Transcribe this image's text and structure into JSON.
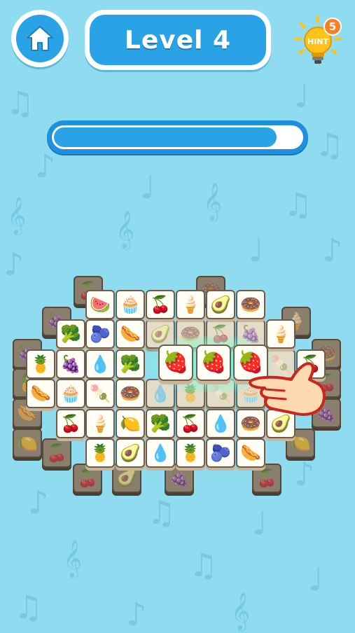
{
  "header": {
    "level_label": "Level 4",
    "home_icon": "home-icon",
    "hint_label": "HINT",
    "hint_count": "5",
    "hint_icon": "lightbulb-icon"
  },
  "progress": {
    "fraction": 0.9
  },
  "colors": {
    "background": "#8fdcf0",
    "button_blue": "#2aa3e6",
    "progress_border": "#1f8fe0",
    "hint_badge": "#fb7f22",
    "hint_bulb": "#ffc21a",
    "highlight": "#7affd2"
  },
  "board": {
    "tiles": [
      {
        "name": "watermelon",
        "icon": "🍉",
        "layer": "top"
      },
      {
        "name": "cupcake",
        "icon": "🧁",
        "layer": "top"
      },
      {
        "name": "cherries",
        "icon": "🍒",
        "layer": "top"
      },
      {
        "name": "ice-cream",
        "icon": "🍦",
        "layer": "top"
      },
      {
        "name": "avocado",
        "icon": "🥑",
        "layer": "top"
      },
      {
        "name": "donut",
        "icon": "🍩",
        "layer": "top"
      },
      {
        "name": "broccoli",
        "icon": "🥦",
        "layer": "top"
      },
      {
        "name": "blueberries",
        "icon": "🫐",
        "layer": "top"
      },
      {
        "name": "hot-dog",
        "icon": "🌭",
        "layer": "top"
      },
      {
        "name": "avocado",
        "icon": "🥑",
        "layer": "mid"
      },
      {
        "name": "donut",
        "icon": "🍩",
        "layer": "mid"
      },
      {
        "name": "cherries",
        "icon": "🍒",
        "layer": "mid"
      },
      {
        "name": "grapes",
        "icon": "🍇",
        "layer": "mid"
      },
      {
        "name": "ice-cream",
        "icon": "🍦",
        "layer": "top"
      },
      {
        "name": "pineapple",
        "icon": "🍍",
        "layer": "top"
      },
      {
        "name": "grapes",
        "icon": "🍇",
        "layer": "top"
      },
      {
        "name": "water-drop",
        "icon": "💧",
        "layer": "top"
      },
      {
        "name": "broccoli",
        "icon": "🥦",
        "layer": "top"
      },
      {
        "name": "ice-pop",
        "icon": "🍡",
        "layer": "mid"
      },
      {
        "name": "cherries",
        "icon": "🍒",
        "layer": "top"
      },
      {
        "name": "hot-dog",
        "icon": "🌭",
        "layer": "top"
      },
      {
        "name": "cupcake",
        "icon": "🧁",
        "layer": "top"
      },
      {
        "name": "ice-pop",
        "icon": "🍡",
        "layer": "top"
      },
      {
        "name": "donut",
        "icon": "🍩",
        "layer": "top"
      },
      {
        "name": "water-drop",
        "icon": "💧",
        "layer": "mid"
      },
      {
        "name": "pineapple",
        "icon": "🍍",
        "layer": "mid"
      },
      {
        "name": "ice-pop",
        "icon": "🍡",
        "layer": "mid"
      },
      {
        "name": "cupcake",
        "icon": "🧁",
        "layer": "mid"
      },
      {
        "name": "cherries",
        "icon": "🍒",
        "layer": "top"
      },
      {
        "name": "ice-cream",
        "icon": "🍦",
        "layer": "top"
      },
      {
        "name": "lemon",
        "icon": "🍋",
        "layer": "top"
      },
      {
        "name": "broccoli",
        "icon": "🥦",
        "layer": "top"
      },
      {
        "name": "cherries",
        "icon": "🍒",
        "layer": "top"
      },
      {
        "name": "water-drop",
        "icon": "💧",
        "layer": "top"
      },
      {
        "name": "donut",
        "icon": "🍩",
        "layer": "top"
      },
      {
        "name": "avocado",
        "icon": "🥑",
        "layer": "top"
      },
      {
        "name": "pineapple",
        "icon": "🍍",
        "layer": "top"
      },
      {
        "name": "avocado",
        "icon": "🥑",
        "layer": "top"
      },
      {
        "name": "water-drop",
        "icon": "💧",
        "layer": "top"
      },
      {
        "name": "pineapple",
        "icon": "🍍",
        "layer": "top"
      },
      {
        "name": "blueberries",
        "icon": "🫐",
        "layer": "top"
      },
      {
        "name": "hot-dog",
        "icon": "🌭",
        "layer": "top"
      },
      {
        "name": "grapes",
        "icon": "🍇",
        "layer": "low"
      },
      {
        "name": "pineapple",
        "icon": "🍍",
        "layer": "low"
      },
      {
        "name": "hot-dog",
        "icon": "🌭",
        "layer": "low"
      },
      {
        "name": "lemon",
        "icon": "🍋",
        "layer": "low"
      },
      {
        "name": "cherries",
        "icon": "🍒",
        "layer": "low"
      },
      {
        "name": "grapes",
        "icon": "🍇",
        "layer": "low"
      },
      {
        "name": "donut",
        "icon": "🍩",
        "layer": "low"
      },
      {
        "name": "cherries",
        "icon": "🍒",
        "layer": "low"
      },
      {
        "name": "lemon",
        "icon": "🍋",
        "layer": "low"
      },
      {
        "name": "grapes",
        "icon": "🍇",
        "layer": "low"
      },
      {
        "name": "cherries",
        "icon": "🍒",
        "layer": "low"
      },
      {
        "name": "donut",
        "icon": "🍩",
        "layer": "low"
      },
      {
        "name": "cherries",
        "icon": "🍒",
        "layer": "low"
      },
      {
        "name": "grapes",
        "icon": "🍇",
        "layer": "low"
      },
      {
        "name": "avocado",
        "icon": "🥑",
        "layer": "low"
      },
      {
        "name": "cherries",
        "icon": "🍒",
        "layer": "low"
      },
      {
        "name": "ice-cream",
        "icon": "🍦",
        "layer": "low"
      },
      {
        "name": "avocado",
        "icon": "🥑",
        "layer": "top"
      }
    ],
    "selected": [
      {
        "name": "strawberry",
        "icon": "🍓"
      },
      {
        "name": "strawberry",
        "icon": "🍓"
      },
      {
        "name": "strawberry",
        "icon": "🍓"
      }
    ]
  }
}
